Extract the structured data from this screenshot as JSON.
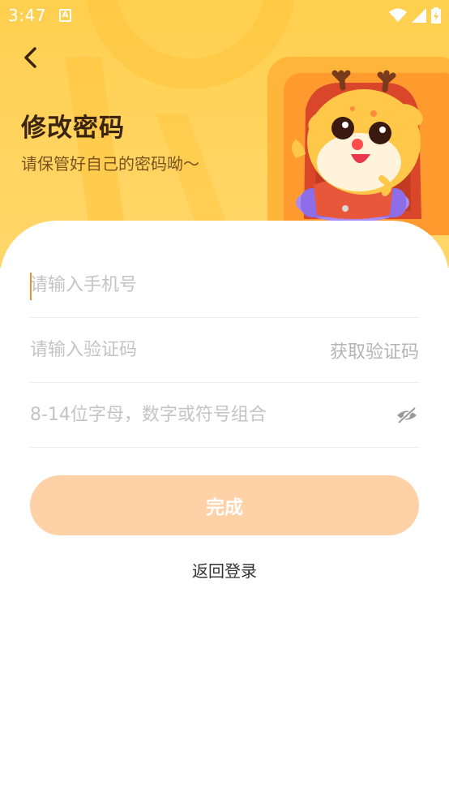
{
  "status_bar": {
    "time": "3:47",
    "app_icon_letter": "A",
    "icons": [
      "wifi-icon",
      "signal-icon",
      "battery-charging-icon"
    ]
  },
  "header": {
    "back_icon": "chevron-left-icon",
    "title": "修改密码",
    "subtitle": "请保管好自己的密码呦～"
  },
  "form": {
    "phone": {
      "value": "",
      "placeholder": "请输入手机号"
    },
    "code": {
      "value": "",
      "placeholder": "请输入验证码",
      "get_code_label": "获取验证码"
    },
    "password": {
      "value": "",
      "placeholder": "8-14位字母，数字或符号组合",
      "visibility_icon": "eye-off-icon"
    }
  },
  "actions": {
    "submit_label": "完成",
    "back_to_login_label": "返回登录"
  },
  "colors": {
    "header_bg": "#ffcf4f",
    "submit_bg": "#fed1a7",
    "cursor": "#f0902a",
    "title": "#3a2410"
  }
}
